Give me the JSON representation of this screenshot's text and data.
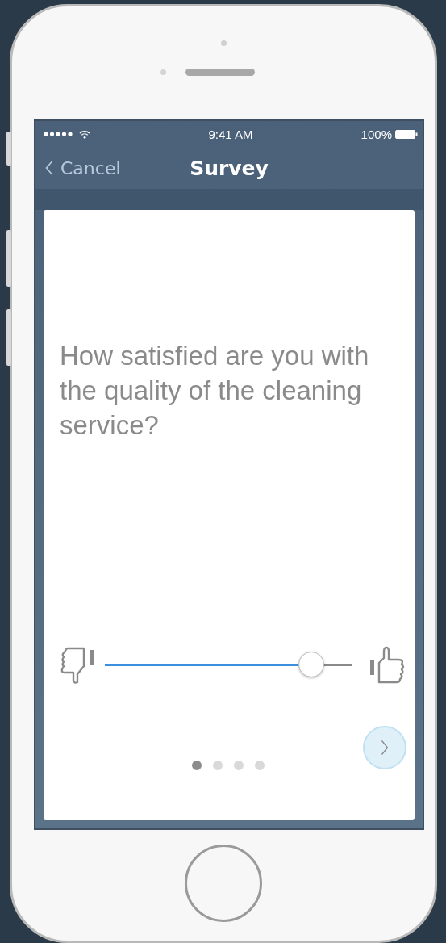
{
  "status_bar": {
    "time": "9:41 AM",
    "battery": "100%"
  },
  "nav": {
    "back": "Cancel",
    "title": "Survey"
  },
  "question": "How satisfied are you with the quality of the cleaning service?",
  "slider": {
    "level": 0.84
  },
  "pages": [
    {
      "selected": true
    },
    {
      "selected": false
    },
    {
      "selected": false
    },
    {
      "selected": false
    }
  ]
}
